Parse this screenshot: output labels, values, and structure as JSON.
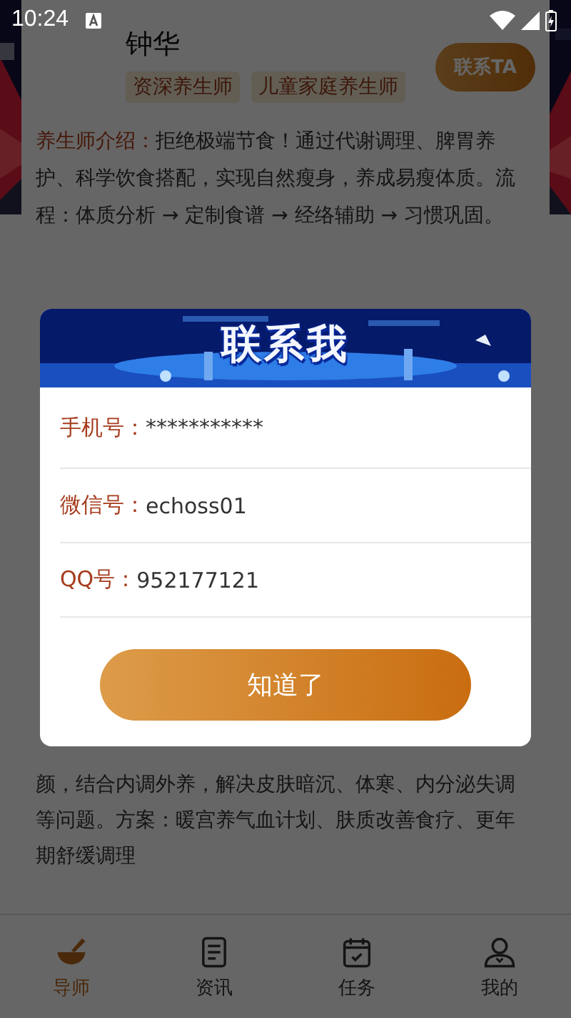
{
  "status_bar": {
    "time": "10:24"
  },
  "profile": {
    "name": "钟华",
    "tags": [
      "资深养生师",
      "儿童家庭养生师"
    ],
    "contact_button": "联系TA",
    "intro_label": "养生师介绍：",
    "intro_text": "拒绝极端节食！通过代谢调理、脾胃养护、科学饮食搭配，实现自然瘦身，养成易瘦体质。流程：体质分析 → 定制食谱 → 经络辅助 → 习惯巩固。"
  },
  "second_intro": {
    "text": "颜，结合内调外养，解决皮肤暗沉、体寒、内分泌失调等问题。方案：暖宫养气血计划、肤质改善食疗、更年期舒缓调理"
  },
  "dialog": {
    "title": "联系我",
    "rows": [
      {
        "label": "手机号：",
        "value": "***********"
      },
      {
        "label": "微信号：",
        "value": "echoss01"
      },
      {
        "label": "QQ号：",
        "value": "952177121"
      }
    ],
    "button": "知道了"
  },
  "tab_bar": [
    {
      "kind": "mentor",
      "label": "导师",
      "selected": true
    },
    {
      "kind": "news",
      "label": "资讯",
      "selected": false
    },
    {
      "kind": "task",
      "label": "任务",
      "selected": false
    },
    {
      "kind": "profile",
      "label": "我的",
      "selected": false
    }
  ]
}
